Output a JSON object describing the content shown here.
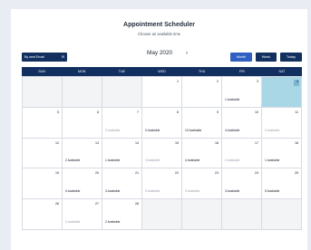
{
  "header": {
    "title": "Appointment Scheduler",
    "subtitle": "Choose an available time"
  },
  "toolbar": {
    "email_button_label": "By sent Email",
    "month_label": "May 2020",
    "next_symbol": "›",
    "views": [
      "Month",
      "Week",
      "Today"
    ]
  },
  "weekdays": [
    "SUN",
    "MON",
    "TUE",
    "WED",
    "THU",
    "FRI",
    "SAT"
  ],
  "cells": [
    {
      "day": "",
      "avail": "",
      "dim": false,
      "empty": true,
      "selected": false
    },
    {
      "day": "",
      "avail": "",
      "dim": false,
      "empty": true,
      "selected": false
    },
    {
      "day": "",
      "avail": "",
      "dim": false,
      "empty": true,
      "selected": false
    },
    {
      "day": "1",
      "avail": "",
      "dim": false,
      "empty": false,
      "selected": false
    },
    {
      "day": "2",
      "avail": "",
      "dim": false,
      "empty": false,
      "selected": false
    },
    {
      "day": "3",
      "avail": "1 Available",
      "dim": false,
      "empty": false,
      "selected": false
    },
    {
      "day": "4",
      "avail": "",
      "dim": false,
      "empty": false,
      "selected": true
    },
    {
      "day": "5",
      "avail": "",
      "dim": false,
      "empty": false,
      "selected": false
    },
    {
      "day": "6",
      "avail": "",
      "dim": false,
      "empty": false,
      "selected": false
    },
    {
      "day": "7",
      "avail": "0 Available",
      "dim": true,
      "empty": false,
      "selected": false
    },
    {
      "day": "8",
      "avail": "0 Available",
      "dim": false,
      "empty": false,
      "selected": false
    },
    {
      "day": "9",
      "avail": "10 Available",
      "dim": false,
      "empty": false,
      "selected": false
    },
    {
      "day": "10",
      "avail": "4 Available",
      "dim": false,
      "empty": false,
      "selected": false
    },
    {
      "day": "11",
      "avail": "0 Available",
      "dim": true,
      "empty": false,
      "selected": false
    },
    {
      "day": "12",
      "avail": "",
      "dim": false,
      "empty": false,
      "selected": false
    },
    {
      "day": "13",
      "avail": "2 Available",
      "dim": false,
      "empty": false,
      "selected": false
    },
    {
      "day": "14",
      "avail": "1 Available",
      "dim": false,
      "empty": false,
      "selected": false
    },
    {
      "day": "15",
      "avail": "3 Available",
      "dim": true,
      "empty": false,
      "selected": false
    },
    {
      "day": "16",
      "avail": "4 Available",
      "dim": false,
      "empty": false,
      "selected": false
    },
    {
      "day": "17",
      "avail": "0 Available",
      "dim": true,
      "empty": false,
      "selected": false
    },
    {
      "day": "18",
      "avail": "1 Available",
      "dim": false,
      "empty": false,
      "selected": false
    },
    {
      "day": "19",
      "avail": "",
      "dim": false,
      "empty": false,
      "selected": false
    },
    {
      "day": "20",
      "avail": "0 Available",
      "dim": false,
      "empty": false,
      "selected": false
    },
    {
      "day": "21",
      "avail": "3 Available",
      "dim": false,
      "empty": false,
      "selected": false
    },
    {
      "day": "22",
      "avail": "0 Available",
      "dim": true,
      "empty": false,
      "selected": false
    },
    {
      "day": "23",
      "avail": "0 Available",
      "dim": true,
      "empty": false,
      "selected": false
    },
    {
      "day": "24",
      "avail": "3 Available",
      "dim": false,
      "empty": false,
      "selected": false
    },
    {
      "day": "25",
      "avail": "5 Available",
      "dim": false,
      "empty": false,
      "selected": false
    },
    {
      "day": "26",
      "avail": "",
      "dim": false,
      "empty": false,
      "selected": false
    },
    {
      "day": "27",
      "avail": "0 Available",
      "dim": true,
      "empty": false,
      "selected": false
    },
    {
      "day": "28",
      "avail": "2 Available",
      "dim": false,
      "empty": false,
      "selected": false
    },
    {
      "day": "",
      "avail": "",
      "dim": false,
      "empty": true,
      "selected": false
    },
    {
      "day": "",
      "avail": "",
      "dim": false,
      "empty": true,
      "selected": false
    },
    {
      "day": "",
      "avail": "",
      "dim": false,
      "empty": true,
      "selected": false
    },
    {
      "day": "",
      "avail": "",
      "dim": false,
      "empty": true,
      "selected": false
    }
  ]
}
